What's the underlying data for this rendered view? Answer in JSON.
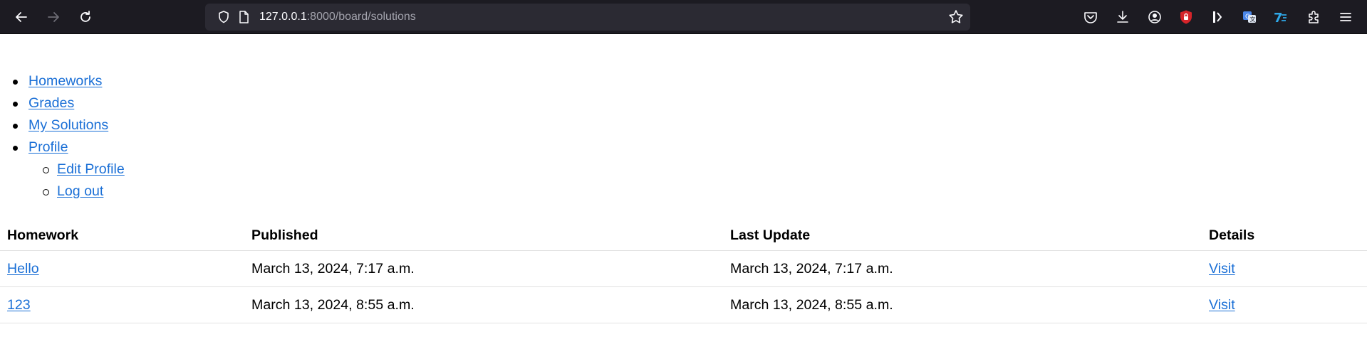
{
  "browser": {
    "url_host": "127.0.0.1",
    "url_rest": ":8000/board/solutions",
    "icons": [
      "back-icon",
      "forward-icon",
      "reload-icon",
      "shield-icon",
      "page-icon",
      "bookmark-star-icon",
      "pocket-icon",
      "download-icon",
      "account-icon",
      "ublock-icon",
      "sidebar-extension-icon",
      "translate-icon",
      "extension-7-icon",
      "extensions-puzzle-icon",
      "menu-icon"
    ]
  },
  "nav": {
    "homeworks": "Homeworks",
    "grades": "Grades",
    "my_solutions": "My Solutions",
    "profile": "Profile",
    "edit_profile": "Edit Profile",
    "log_out": "Log out"
  },
  "table": {
    "headers": [
      "Homework",
      "Published",
      "Last Update",
      "Details"
    ],
    "rows": [
      {
        "homework": "Hello",
        "published": "March 13, 2024, 7:17 a.m.",
        "last_update": "March 13, 2024, 7:17 a.m.",
        "details": "Visit"
      },
      {
        "homework": "123",
        "published": "March 13, 2024, 8:55 a.m.",
        "last_update": "March 13, 2024, 8:55 a.m.",
        "details": "Visit"
      }
    ]
  },
  "colors": {
    "link": "#1a6fd6",
    "toolbar": "#1c1b22",
    "urlbar": "#2b2a33"
  }
}
